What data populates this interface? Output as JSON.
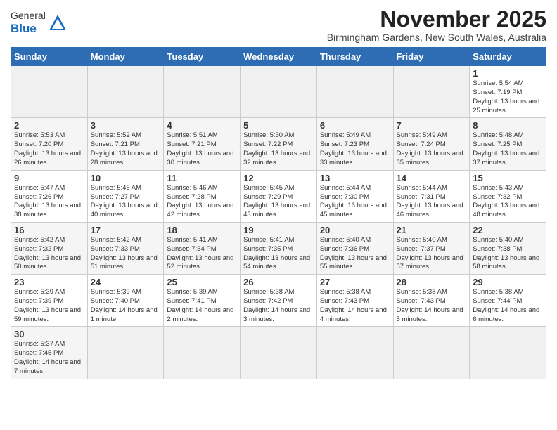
{
  "header": {
    "logo_general": "General",
    "logo_blue": "Blue",
    "month_title": "November 2025",
    "location": "Birmingham Gardens, New South Wales, Australia"
  },
  "weekdays": [
    "Sunday",
    "Monday",
    "Tuesday",
    "Wednesday",
    "Thursday",
    "Friday",
    "Saturday"
  ],
  "weeks": [
    [
      {
        "day": "",
        "empty": true
      },
      {
        "day": "",
        "empty": true
      },
      {
        "day": "",
        "empty": true
      },
      {
        "day": "",
        "empty": true
      },
      {
        "day": "",
        "empty": true
      },
      {
        "day": "",
        "empty": true
      },
      {
        "day": "1",
        "sunrise": "5:54 AM",
        "sunset": "7:19 PM",
        "daylight": "13 hours and 25 minutes."
      }
    ],
    [
      {
        "day": "2",
        "sunrise": "5:53 AM",
        "sunset": "7:20 PM",
        "daylight": "13 hours and 26 minutes."
      },
      {
        "day": "3",
        "sunrise": "5:52 AM",
        "sunset": "7:21 PM",
        "daylight": "13 hours and 28 minutes."
      },
      {
        "day": "4",
        "sunrise": "5:51 AM",
        "sunset": "7:21 PM",
        "daylight": "13 hours and 30 minutes."
      },
      {
        "day": "5",
        "sunrise": "5:50 AM",
        "sunset": "7:22 PM",
        "daylight": "13 hours and 32 minutes."
      },
      {
        "day": "6",
        "sunrise": "5:49 AM",
        "sunset": "7:23 PM",
        "daylight": "13 hours and 33 minutes."
      },
      {
        "day": "7",
        "sunrise": "5:49 AM",
        "sunset": "7:24 PM",
        "daylight": "13 hours and 35 minutes."
      },
      {
        "day": "8",
        "sunrise": "5:48 AM",
        "sunset": "7:25 PM",
        "daylight": "13 hours and 37 minutes."
      }
    ],
    [
      {
        "day": "9",
        "sunrise": "5:47 AM",
        "sunset": "7:26 PM",
        "daylight": "13 hours and 38 minutes."
      },
      {
        "day": "10",
        "sunrise": "5:46 AM",
        "sunset": "7:27 PM",
        "daylight": "13 hours and 40 minutes."
      },
      {
        "day": "11",
        "sunrise": "5:46 AM",
        "sunset": "7:28 PM",
        "daylight": "13 hours and 42 minutes."
      },
      {
        "day": "12",
        "sunrise": "5:45 AM",
        "sunset": "7:29 PM",
        "daylight": "13 hours and 43 minutes."
      },
      {
        "day": "13",
        "sunrise": "5:44 AM",
        "sunset": "7:30 PM",
        "daylight": "13 hours and 45 minutes."
      },
      {
        "day": "14",
        "sunrise": "5:44 AM",
        "sunset": "7:31 PM",
        "daylight": "13 hours and 46 minutes."
      },
      {
        "day": "15",
        "sunrise": "5:43 AM",
        "sunset": "7:32 PM",
        "daylight": "13 hours and 48 minutes."
      }
    ],
    [
      {
        "day": "16",
        "sunrise": "5:42 AM",
        "sunset": "7:32 PM",
        "daylight": "13 hours and 50 minutes."
      },
      {
        "day": "17",
        "sunrise": "5:42 AM",
        "sunset": "7:33 PM",
        "daylight": "13 hours and 51 minutes."
      },
      {
        "day": "18",
        "sunrise": "5:41 AM",
        "sunset": "7:34 PM",
        "daylight": "13 hours and 52 minutes."
      },
      {
        "day": "19",
        "sunrise": "5:41 AM",
        "sunset": "7:35 PM",
        "daylight": "13 hours and 54 minutes."
      },
      {
        "day": "20",
        "sunrise": "5:40 AM",
        "sunset": "7:36 PM",
        "daylight": "13 hours and 55 minutes."
      },
      {
        "day": "21",
        "sunrise": "5:40 AM",
        "sunset": "7:37 PM",
        "daylight": "13 hours and 57 minutes."
      },
      {
        "day": "22",
        "sunrise": "5:40 AM",
        "sunset": "7:38 PM",
        "daylight": "13 hours and 58 minutes."
      }
    ],
    [
      {
        "day": "23",
        "sunrise": "5:39 AM",
        "sunset": "7:39 PM",
        "daylight": "13 hours and 59 minutes."
      },
      {
        "day": "24",
        "sunrise": "5:39 AM",
        "sunset": "7:40 PM",
        "daylight": "14 hours and 1 minute."
      },
      {
        "day": "25",
        "sunrise": "5:39 AM",
        "sunset": "7:41 PM",
        "daylight": "14 hours and 2 minutes."
      },
      {
        "day": "26",
        "sunrise": "5:38 AM",
        "sunset": "7:42 PM",
        "daylight": "14 hours and 3 minutes."
      },
      {
        "day": "27",
        "sunrise": "5:38 AM",
        "sunset": "7:43 PM",
        "daylight": "14 hours and 4 minutes."
      },
      {
        "day": "28",
        "sunrise": "5:38 AM",
        "sunset": "7:43 PM",
        "daylight": "14 hours and 5 minutes."
      },
      {
        "day": "29",
        "sunrise": "5:38 AM",
        "sunset": "7:44 PM",
        "daylight": "14 hours and 6 minutes."
      }
    ],
    [
      {
        "day": "30",
        "sunrise": "5:37 AM",
        "sunset": "7:45 PM",
        "daylight": "14 hours and 7 minutes."
      },
      {
        "day": "",
        "empty": true
      },
      {
        "day": "",
        "empty": true
      },
      {
        "day": "",
        "empty": true
      },
      {
        "day": "",
        "empty": true
      },
      {
        "day": "",
        "empty": true
      },
      {
        "day": "",
        "empty": true
      }
    ]
  ],
  "labels": {
    "sunrise": "Sunrise: ",
    "sunset": "Sunset: ",
    "daylight": "Daylight: "
  }
}
